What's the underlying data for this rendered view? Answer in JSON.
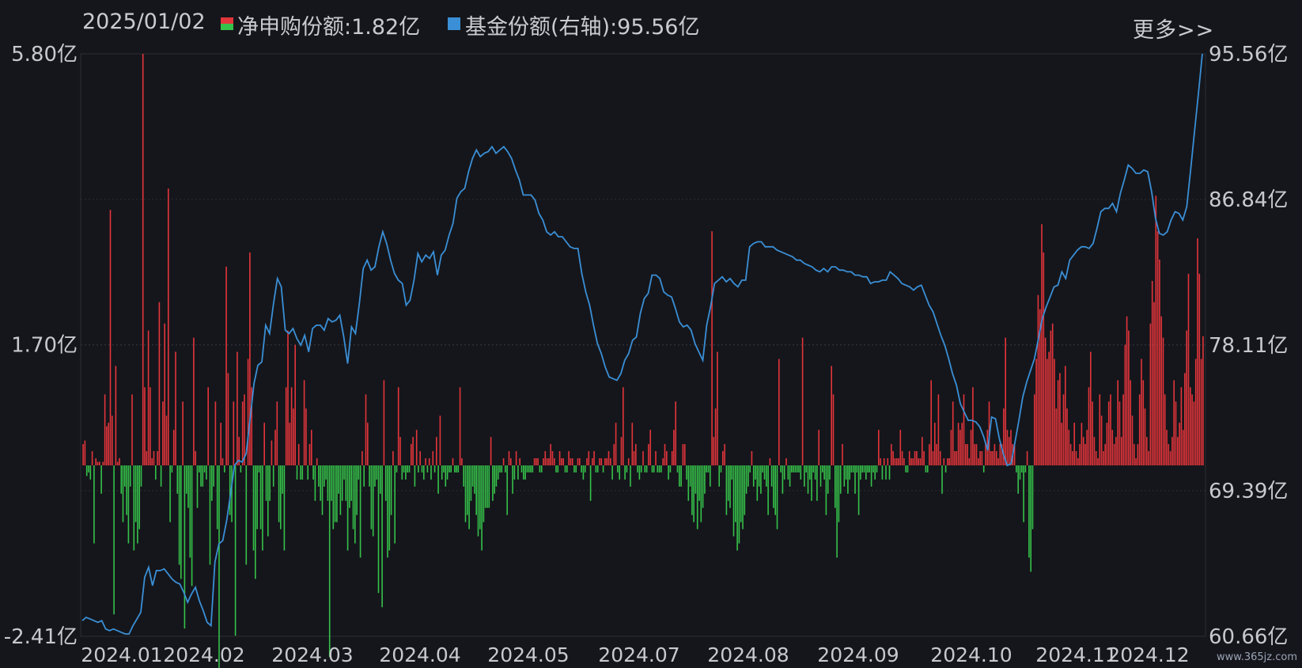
{
  "header": {
    "date": "2025/01/02",
    "legend_red_label": "净申购份额:1.82亿",
    "legend_blue_label": "基金份额(右轴):95.56亿",
    "more_label": "更多>>",
    "watermark": "www.365jz.com"
  },
  "colors": {
    "background": "#15161b",
    "up_bar": "#e3353b",
    "down_bar": "#35c24a",
    "line": "#3a8fd6",
    "grid": "#2c2e36",
    "text": "#c7c9cf"
  },
  "chart_data": {
    "type": "bar+line",
    "title": "",
    "left_axis": {
      "ticks": [
        "5.80亿",
        "1.70亿",
        "-2.41亿"
      ],
      "ylim": [
        -2.41,
        5.8
      ],
      "unit": "亿"
    },
    "right_axis": {
      "ticks": [
        "95.56亿",
        "86.84亿",
        "78.11亿",
        "69.39亿",
        "60.66亿"
      ],
      "ylim": [
        60.66,
        95.56
      ],
      "unit": "亿"
    },
    "x_ticks": [
      "2024.01",
      "2024.02",
      "2024.03",
      "2024.04",
      "2024.05",
      "2024.07",
      "2024.08",
      "2024.09",
      "2024.10",
      "2024.11",
      "2024.12"
    ],
    "series": [
      {
        "name": "净申购份额",
        "type": "bar",
        "values": [
          0.3,
          0.35,
          -0.15,
          -0.1,
          -0.2,
          0.2,
          -1.1,
          0.1,
          0.05,
          0.05,
          -0.4,
          0.05,
          1.0,
          0.55,
          0.6,
          3.6,
          0.7,
          -2.1,
          1.4,
          0.05,
          0.1,
          -0.4,
          -0.8,
          -0.3,
          -0.7,
          -1.1,
          -0.3,
          1.0,
          -1.2,
          -0.8,
          -1.1,
          -0.9,
          -0.3,
          5.8,
          1.1,
          0.2,
          1.9,
          1.1,
          0.1,
          0.2,
          -0.2,
          0.2,
          2.3,
          -0.3,
          0.9,
          2.0,
          0.7,
          3.9,
          -0.8,
          -0.1,
          0.5,
          1.6,
          -0.4,
          -1.4,
          -1.6,
          0.9,
          -2.3,
          -0.4,
          -0.6,
          -1.3,
          -1.7,
          1.8,
          0.2,
          -0.6,
          -0.1,
          -0.3,
          -0.3,
          -0.1,
          -0.2,
          1.1,
          -1.4,
          -0.5,
          -0.3,
          0.9,
          -0.9,
          -2.9,
          0.6,
          0.1,
          -0.1,
          2.8,
          1.3,
          -0.7,
          -0.8,
          0.9,
          -2.4,
          1.6,
          0.4,
          -0.1,
          0.9,
          1.0,
          -1.4,
          1.5,
          3.0,
          1.1,
          -1.2,
          -1.6,
          -0.9,
          -0.1,
          -0.9,
          -1.2,
          0.6,
          -0.5,
          -1.0,
          -0.5,
          0.35,
          -0.3,
          0.5,
          0.9,
          -0.8,
          -0.9,
          -0.4,
          -1.2,
          1.1,
          1.9,
          0.6,
          1.1,
          0.8,
          1.7,
          -0.2,
          0.3,
          -0.2,
          -0.2,
          1.2,
          0.8,
          -0.2,
          0.3,
          0.5,
          -0.2,
          -0.5,
          0.1,
          -0.3,
          -0.5,
          -0.7,
          -0.3,
          -0.2,
          -0.5,
          -2.7,
          -0.5,
          -0.9,
          -0.8,
          -0.8,
          -0.4,
          -0.7,
          -0.5,
          -0.2,
          -0.5,
          -1.2,
          -0.6,
          -0.5,
          -0.9,
          -1.1,
          -0.7,
          -0.2,
          -1.3,
          0.2,
          -0.3,
          1.0,
          0.6,
          -0.3,
          -0.9,
          -1.0,
          -0.3,
          -0.2,
          -1.8,
          -0.4,
          -2.0,
          1.2,
          -0.5,
          -1.3,
          -1.2,
          -0.7,
          0.2,
          -1.1,
          -0.1,
          1.1,
          0.4,
          -0.2,
          -0.1,
          -0.2,
          -0.1,
          -0.1,
          0.3,
          0.4,
          -0.3,
          0.5,
          -0.1,
          0.2,
          -0.1,
          -0.2,
          0.1,
          -0.1,
          0.1,
          -0.2,
          0.2,
          -0.1,
          0.4,
          -0.4,
          0.7,
          -0.2,
          -0.1,
          -0.3,
          -0.2,
          -0.1,
          -0.1,
          0.1,
          -0.1,
          -0.1,
          -0.1,
          1.1,
          0.1,
          -0.3,
          -0.8,
          -0.7,
          -0.9,
          -0.5,
          -0.3,
          -0.4,
          -0.7,
          -1.0,
          -0.9,
          -1.2,
          -0.8,
          -0.6,
          -0.6,
          -0.6,
          0.4,
          -0.5,
          -0.4,
          -0.3,
          -0.2,
          -0.1,
          -0.1,
          0.1,
          -0.1,
          -0.7,
          0.2,
          0.1,
          -0.4,
          -0.2,
          0.2,
          -0.2,
          0.1,
          -0.1,
          -0.2,
          -0.2,
          -0.1,
          -0.1,
          -0.1,
          -0.1,
          0.1,
          0.1,
          0.1,
          -0.1,
          -0.1,
          0.1,
          0.2,
          0.1,
          0.1,
          0.3,
          0.2,
          0.1,
          -0.1,
          -0.1,
          0.2,
          0.1,
          0.1,
          -0.1,
          -0.1,
          0.2,
          0.1,
          0.1,
          -0.1,
          -0.1,
          0.1,
          0.1,
          -0.1,
          -0.2,
          -0.1,
          0.1,
          0.2,
          -0.5,
          0.1,
          0.2,
          -0.1,
          -0.1,
          0.1,
          0.1,
          -0.1,
          0.1,
          0.1,
          0.2,
          0.1,
          -0.2,
          0.3,
          0.6,
          -0.1,
          -0.2,
          0.4,
          1.1,
          -0.2,
          -0.1,
          0.1,
          -0.3,
          0.6,
          0.2,
          0.3,
          -0.1,
          -0.2,
          -0.1,
          0.2,
          -0.1,
          -0.1,
          0.3,
          0.5,
          -0.1,
          -0.1,
          0.2,
          -0.1,
          -0.1,
          -0.1,
          0.1,
          0.3,
          0.2,
          -0.2,
          -0.1,
          0.2,
          0.5,
          0.9,
          -0.1,
          -0.3,
          -0.3,
          0.3,
          0.3,
          -0.2,
          -0.5,
          -0.3,
          -0.7,
          -0.8,
          -0.4,
          -0.9,
          -0.5,
          -0.8,
          -0.6,
          -0.4,
          -0.1,
          -0.1,
          -0.3,
          3.3,
          0.4,
          0.8,
          1.6,
          -0.3,
          -0.1,
          0.2,
          0.3,
          -0.7,
          -0.5,
          -0.6,
          -0.2,
          -1.0,
          -0.8,
          -1.2,
          -1.1,
          -0.8,
          -0.9,
          -0.7,
          -0.4,
          -0.3,
          -0.1,
          0.2,
          -0.3,
          -0.2,
          -0.5,
          -0.3,
          -0.4,
          -0.1,
          -0.2,
          -0.3,
          -0.7,
          0.1,
          -0.3,
          -0.6,
          -0.7,
          -0.9,
          1.5,
          -0.1,
          -0.4,
          -0.2,
          0.1,
          -0.2,
          -0.3,
          -0.1,
          -0.1,
          -0.1,
          -0.1,
          -0.1,
          -0.2,
          1.8,
          -0.3,
          -0.1,
          -0.4,
          -0.2,
          -0.5,
          -0.1,
          -0.2,
          -0.5,
          0.5,
          -0.3,
          -0.1,
          -0.2,
          -0.7,
          -0.4,
          -0.2,
          1.4,
          1.0,
          -0.6,
          -1.3,
          -0.8,
          -0.4,
          0.3,
          -0.3,
          -0.2,
          -0.4,
          -0.2,
          -0.1,
          -0.1,
          -0.4,
          -0.1,
          -0.7,
          -0.2,
          -0.1,
          -0.1,
          -0.2,
          -0.1,
          -0.1,
          -0.3,
          -0.1,
          -0.2,
          -0.1,
          0.5,
          0.1,
          -0.2,
          0.1,
          -0.2,
          0.1,
          -0.2,
          0.3,
          0.2,
          0.1,
          0.1,
          0.1,
          0.5,
          0.2,
          0.1,
          -0.1,
          -0.1,
          0.2,
          0.1,
          0.1,
          0.2,
          0.2,
          0.1,
          0.1,
          0.4,
          0.2,
          -0.1,
          -0.1,
          0.3,
          1.2,
          0.2,
          0.6,
          0.3,
          1.0,
          0.2,
          -0.4,
          0.1,
          -0.1,
          0.1,
          0.1,
          0.5,
          0.9,
          0.2,
          0.2,
          0.6,
          0.5,
          0.6,
          1.0,
          0.3,
          0.3,
          0.1,
          0.5,
          1.1,
          0.3,
          0.3,
          0.1,
          0.2,
          0.2,
          -0.1,
          0.3,
          0.5,
          0.9,
          0.2,
          0.2,
          0.3,
          0.2,
          0.1,
          0.3,
          0.3,
          0.8,
          1.8,
          0.5,
          0.4,
          0.5,
          0.3,
          0.3,
          -0.1,
          -0.4,
          -0.2,
          -0.1,
          -0.8,
          -0.1,
          0.2,
          -1.3,
          -1.5,
          -0.9,
          1.0,
          1.5,
          2.4,
          2.2,
          3.4,
          3.0,
          1.8,
          1.5,
          1.6,
          1.9,
          2.0,
          1.5,
          0.8,
          1.2,
          1.3,
          0.6,
          1.0,
          1.4,
          0.8,
          0.5,
          0.3,
          0.2,
          0.6,
          0.2,
          0.1,
          0.3,
          0.6,
          0.4,
          0.3,
          0.5,
          1.1,
          1.6,
          0.9,
          0.4,
          0.2,
          0.1,
          1.0,
          0.7,
          0.2,
          0.3,
          0.6,
          0.9,
          1.0,
          0.5,
          0.3,
          0.4,
          1.2,
          0.9,
          0.4,
          1.0,
          1.7,
          2.1,
          1.9,
          1.2,
          0.7,
          0.3,
          0.1,
          0.3,
          1.0,
          1.5,
          1.2,
          0.8,
          0.4,
          0.2,
          2.0,
          2.6,
          2.3,
          3.8,
          3.3,
          2.9,
          2.1,
          1.8,
          1.0,
          0.5,
          0.3,
          0.2,
          0.4,
          1.2,
          0.9,
          0.4,
          0.6,
          1.1,
          0.5,
          1.3,
          1.9,
          2.7,
          1.1,
          1.0,
          0.9,
          1.5,
          3.2,
          2.7,
          1.5,
          1.82
        ]
      },
      {
        "name": "基金份额",
        "type": "line",
        "axis": "right",
        "values": [
          61.6,
          61.8,
          61.7,
          61.6,
          61.5,
          61.6,
          61.1,
          61.0,
          61.1,
          61.0,
          60.9,
          60.8,
          60.8,
          61.3,
          61.7,
          62.1,
          64.2,
          64.8,
          63.7,
          64.6,
          64.6,
          64.7,
          64.4,
          64.1,
          63.9,
          63.8,
          63.3,
          62.7,
          63.2,
          63.6,
          62.8,
          62.2,
          61.5,
          61.3,
          65.1,
          66.2,
          66.4,
          67.6,
          69.2,
          70.9,
          71.2,
          71.1,
          71.6,
          73.7,
          75.8,
          76.9,
          77.1,
          79.3,
          78.8,
          80.6,
          82.1,
          81.6,
          79.0,
          78.8,
          79.1,
          78.5,
          78.1,
          78.7,
          77.7,
          79.1,
          79.3,
          79.3,
          79.0,
          79.7,
          79.5,
          79.6,
          79.9,
          78.6,
          77.0,
          79.2,
          78.8,
          80.6,
          82.7,
          83.2,
          82.6,
          82.8,
          84.0,
          84.9,
          84.2,
          83.2,
          82.4,
          82.0,
          81.8,
          80.5,
          80.8,
          82.0,
          83.6,
          83.1,
          83.5,
          83.3,
          83.7,
          82.3,
          83.5,
          83.8,
          84.7,
          85.4,
          86.9,
          87.3,
          87.5,
          88.5,
          89.3,
          89.8,
          89.4,
          89.6,
          89.7,
          90.0,
          89.6,
          89.8,
          90.0,
          89.7,
          89.3,
          88.6,
          88.0,
          87.1,
          87.1,
          87.1,
          86.8,
          86.0,
          85.6,
          84.9,
          84.7,
          84.9,
          84.6,
          84.6,
          84.3,
          84.0,
          83.9,
          83.9,
          82.4,
          81.3,
          80.5,
          79.3,
          78.2,
          77.6,
          76.8,
          76.2,
          76.1,
          76.0,
          76.4,
          77.2,
          77.6,
          78.4,
          78.6,
          80.0,
          80.9,
          81.2,
          82.3,
          82.3,
          82.1,
          81.3,
          81.1,
          81.0,
          80.3,
          79.5,
          79.2,
          79.3,
          79.0,
          78.2,
          77.7,
          77.2,
          79.3,
          80.4,
          81.8,
          82.0,
          82.2,
          81.9,
          82.1,
          81.8,
          81.6,
          82.0,
          82.0,
          84.0,
          84.2,
          84.3,
          84.3,
          84.0,
          84.0,
          84.0,
          83.8,
          83.7,
          83.6,
          83.5,
          83.4,
          83.2,
          83.2,
          83.0,
          82.9,
          82.8,
          82.6,
          82.5,
          82.7,
          82.5,
          82.8,
          82.8,
          82.6,
          82.6,
          82.5,
          82.5,
          82.3,
          82.3,
          82.2,
          82.2,
          81.8,
          81.9,
          81.9,
          82.0,
          82.0,
          82.5,
          82.3,
          82.1,
          81.8,
          81.7,
          81.6,
          81.4,
          81.6,
          81.7,
          81.1,
          80.5,
          80.1,
          79.4,
          78.7,
          78.1,
          77.3,
          76.4,
          75.7,
          74.6,
          74.1,
          73.6,
          73.6,
          73.5,
          73.2,
          72.6,
          71.8,
          73.8,
          73.7,
          72.5,
          71.6,
          70.9,
          71.0,
          72.3,
          73.6,
          75.0,
          75.9,
          76.6,
          77.3,
          78.5,
          79.7,
          80.4,
          81.0,
          81.6,
          81.7,
          82.5,
          82.1,
          83.2,
          83.5,
          83.8,
          84.0,
          84.0,
          83.9,
          84.2,
          85.1,
          86.1,
          86.3,
          86.3,
          86.6,
          86.1,
          87.2,
          88.0,
          88.9,
          88.7,
          88.4,
          88.4,
          88.6,
          88.5,
          87.3,
          85.7,
          84.8,
          84.7,
          84.9,
          85.6,
          86.1,
          86.0,
          85.6,
          86.4,
          88.6,
          90.9,
          93.2,
          95.56
        ]
      }
    ]
  }
}
